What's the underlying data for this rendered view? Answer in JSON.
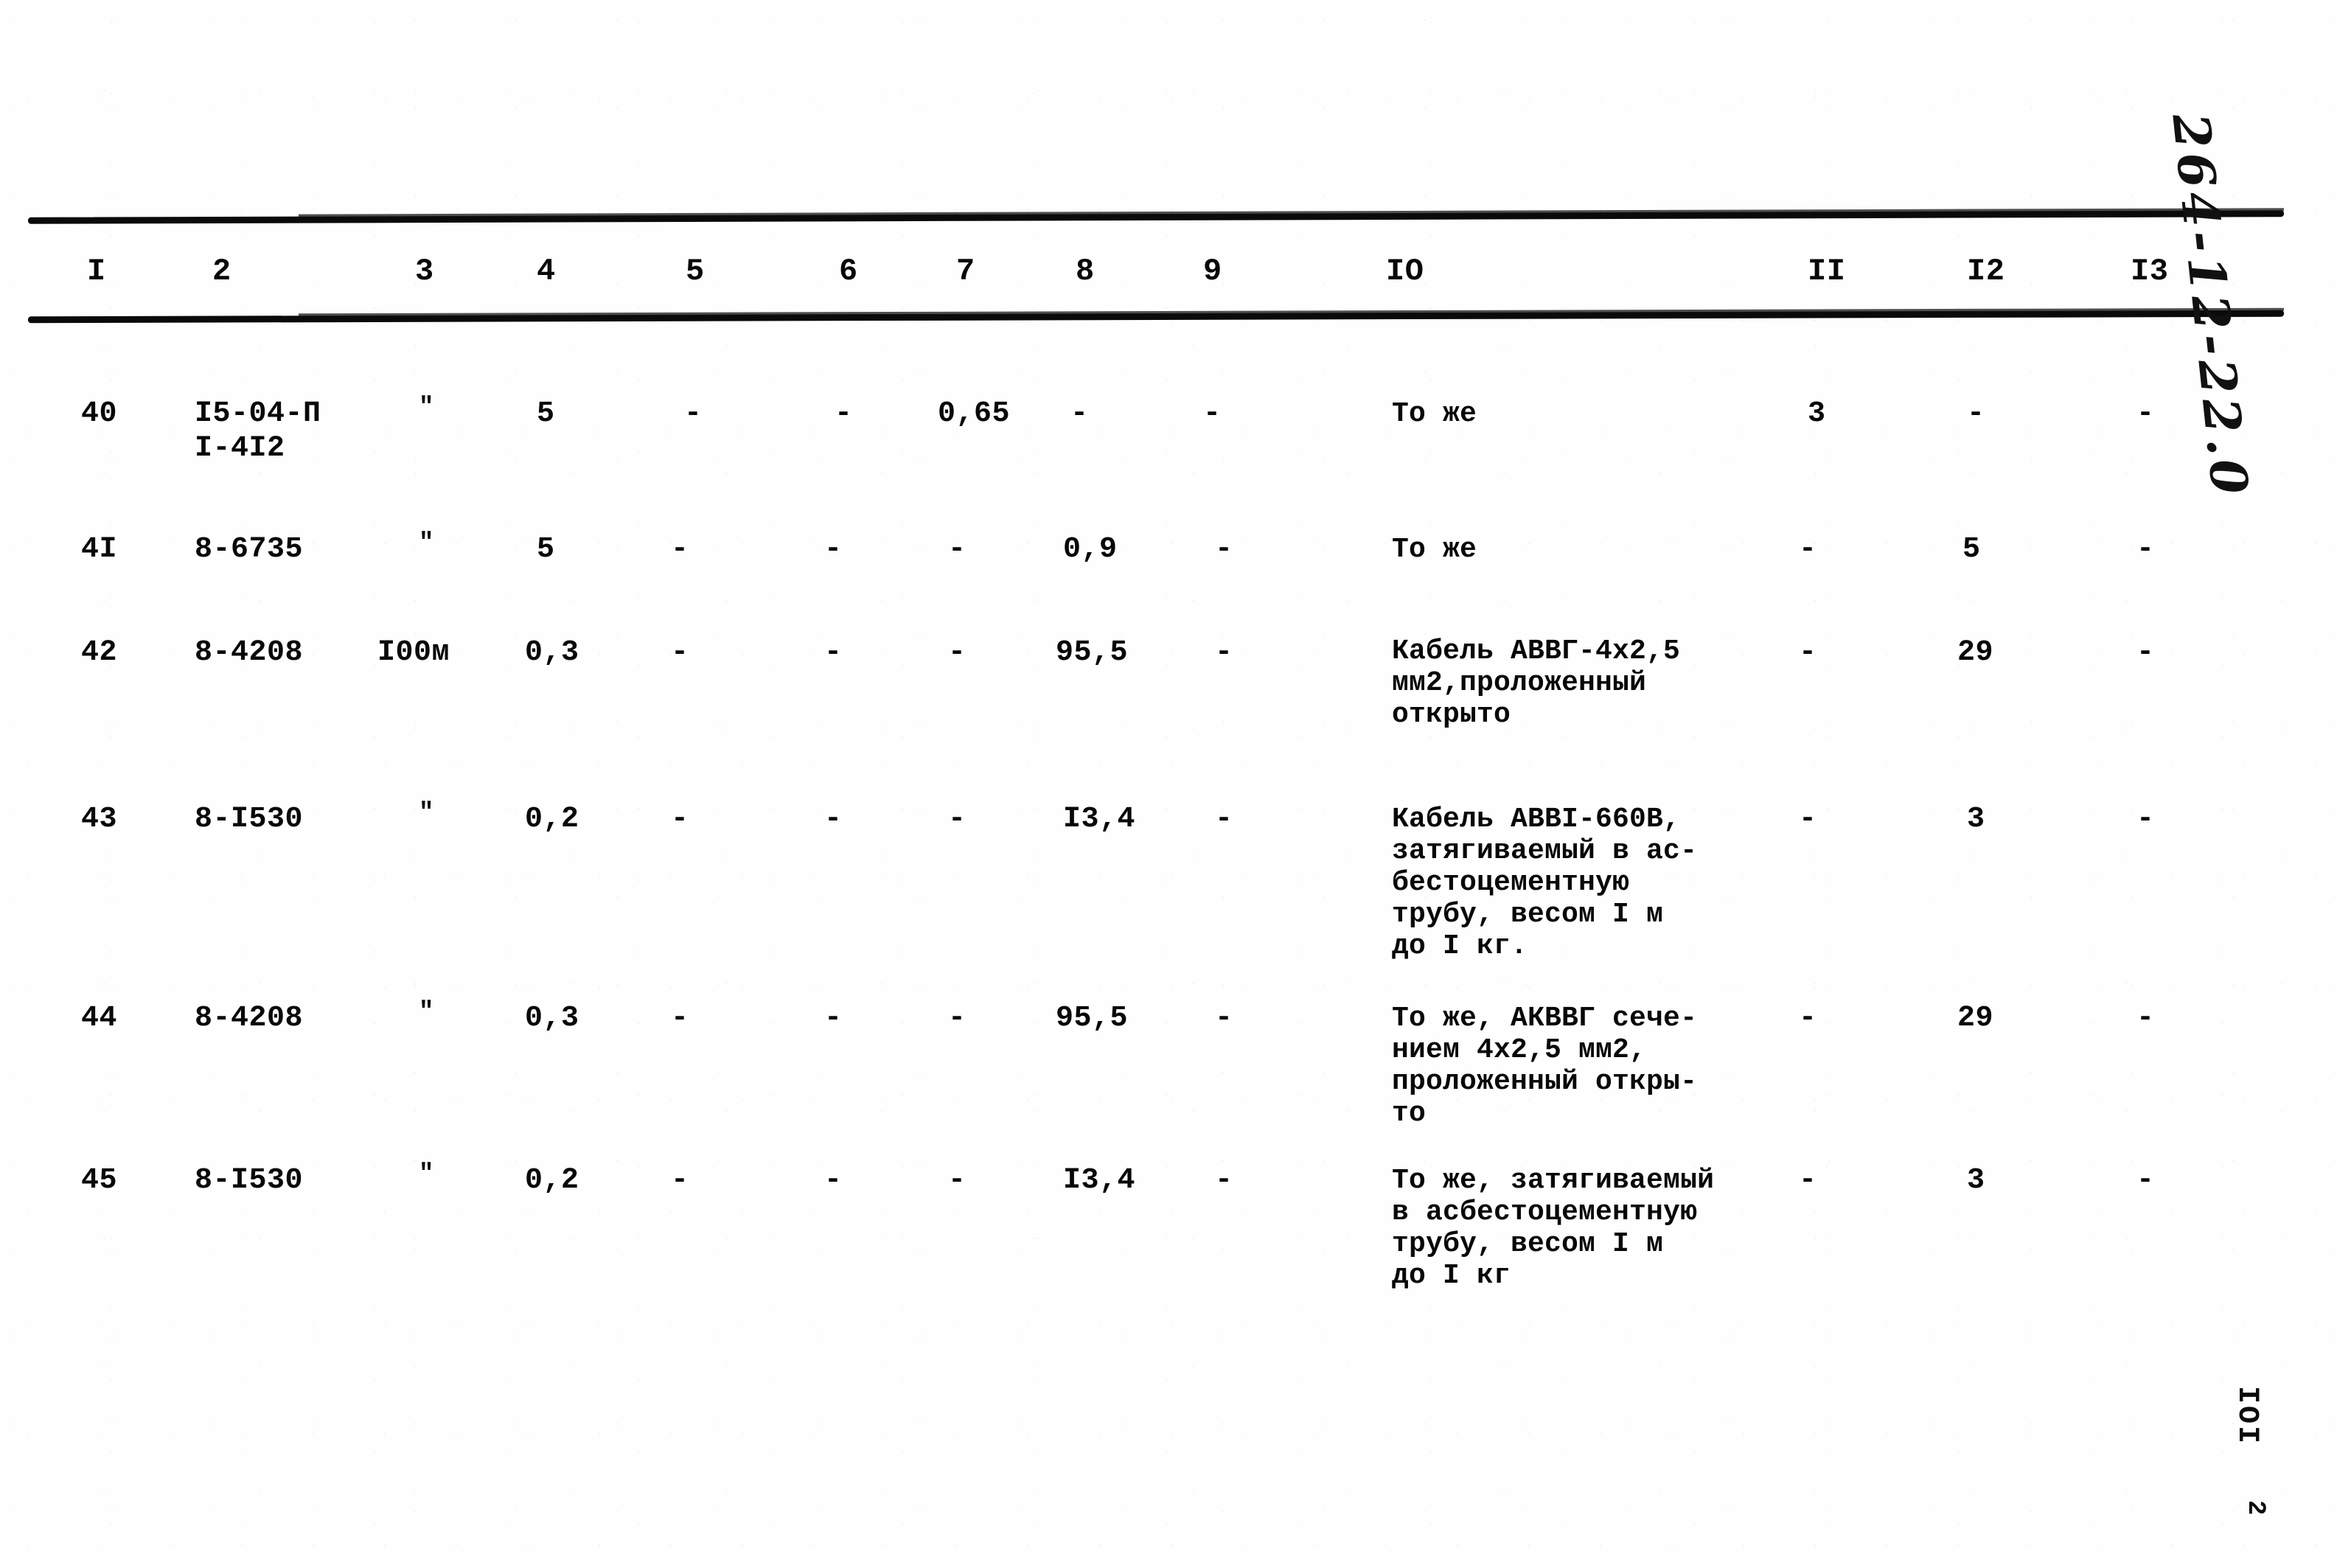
{
  "document": {
    "margin_annotation": "264-12-22.0",
    "page_number": "IOI",
    "page_mark": "2"
  },
  "table": {
    "headers": [
      "I",
      "2",
      "3",
      "4",
      "5",
      "6",
      "7",
      "8",
      "9",
      "IO",
      "II",
      "I2",
      "I3"
    ],
    "rows": [
      {
        "c1": "40",
        "c2": "I5-04-П\nI-4I2",
        "c3": "\"",
        "c4": "5",
        "c5": "-",
        "c6": "-",
        "c7": "0,65",
        "c8": "-",
        "c9": "-",
        "c10": "То же",
        "c11": "3",
        "c12": "-",
        "c13": "-"
      },
      {
        "c1": "4I",
        "c2": "8-6735",
        "c3": "\"",
        "c4": "5",
        "c5": "-",
        "c6": "-",
        "c7": "-",
        "c8": "0,9",
        "c9": "-",
        "c10": "То же",
        "c11": "-",
        "c12": "5",
        "c13": "-"
      },
      {
        "c1": "42",
        "c2": "8-4208",
        "c3": "I00м",
        "c4": "0,3",
        "c5": "-",
        "c6": "-",
        "c7": "-",
        "c8": "95,5",
        "c9": "-",
        "c10": "Кабель АВВГ-4х2,5\nмм2,проложенный\nоткрыто",
        "c11": "-",
        "c12": "29",
        "c13": "-"
      },
      {
        "c1": "43",
        "c2": "8-I530",
        "c3": "\"",
        "c4": "0,2",
        "c5": "-",
        "c6": "-",
        "c7": "-",
        "c8": "I3,4",
        "c9": "-",
        "c10": "Кабель АВВI-660В,\nзатягиваемый в ас-\nбестоцементную\nтрубу, весом I м\nдо I кг.",
        "c11": "-",
        "c12": "3",
        "c13": "-"
      },
      {
        "c1": "44",
        "c2": "8-4208",
        "c3": "\"",
        "c4": "0,3",
        "c5": "-",
        "c6": "-",
        "c7": "-",
        "c8": "95,5",
        "c9": "-",
        "c10": "То же, АКВВГ сече-\nнием 4х2,5 мм2,\nпроложенный откры-\nто",
        "c11": "-",
        "c12": "29",
        "c13": "-"
      },
      {
        "c1": "45",
        "c2": "8-I530",
        "c3": "\"",
        "c4": "0,2",
        "c5": "-",
        "c6": "-",
        "c7": "-",
        "c8": "I3,4",
        "c9": "-",
        "c10": "То же, затягиваемый\nв асбестоцементную\nтрубу, весом I м\nдо I кг",
        "c11": "-",
        "c12": "3",
        "c13": "-"
      }
    ]
  }
}
